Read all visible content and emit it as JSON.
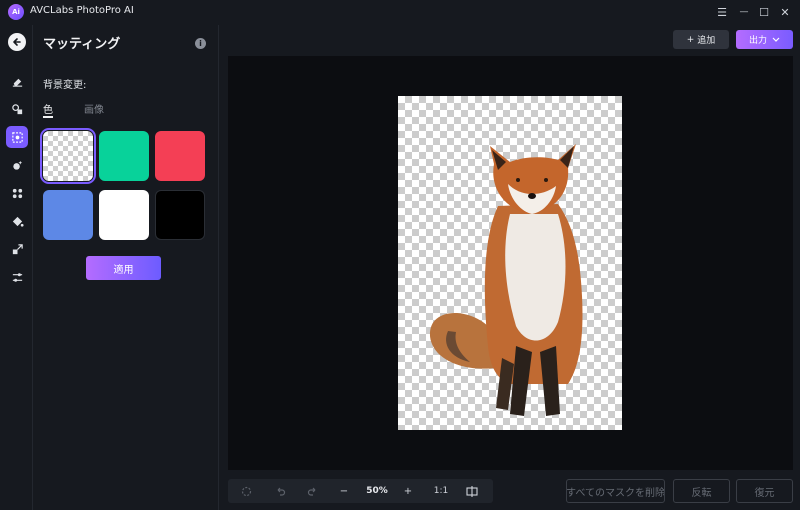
{
  "app": {
    "title": "AVCLabs PhotoPro AI",
    "logo_text": "Ai",
    "window_controls": {
      "menu": "☰",
      "minimize": "—",
      "maximize": "☐",
      "close": "✕"
    }
  },
  "rail": {
    "back": "arrow-left-icon",
    "items": [
      {
        "name": "eraser-icon"
      },
      {
        "name": "object-replace-icon"
      },
      {
        "name": "matting-icon",
        "active": true
      },
      {
        "name": "face-enhance-icon"
      },
      {
        "name": "effects-icon"
      },
      {
        "name": "fill-bucket-icon"
      },
      {
        "name": "upscale-icon"
      },
      {
        "name": "adjust-sliders-icon"
      }
    ]
  },
  "panel": {
    "title": "マッティング",
    "section_label": "背景変更:",
    "tabs": [
      {
        "label": "色",
        "active": true
      },
      {
        "label": "画像",
        "active": false
      }
    ],
    "swatches": [
      {
        "name": "transparent",
        "color": "transparent",
        "selected": true
      },
      {
        "name": "green",
        "color": "#08d29a",
        "selected": false
      },
      {
        "name": "red",
        "color": "#f43f55",
        "selected": false
      },
      {
        "name": "blue",
        "color": "#5d88e6",
        "selected": false
      },
      {
        "name": "white",
        "color": "#ffffff",
        "selected": false
      },
      {
        "name": "black",
        "color": "#000000",
        "selected": false
      }
    ],
    "apply_label": "適用"
  },
  "topbar": {
    "add_label": "追加",
    "add_icon": "+",
    "export_label": "出力",
    "export_icon": "chevron-down-icon"
  },
  "toolbar": {
    "zoom_out": "−",
    "zoom_value": "50%",
    "zoom_in": "+",
    "actual_size": "1:1",
    "compare_icon": "compare-icon"
  },
  "actions": {
    "delete_all_masks": "すべてのマスクを削除",
    "invert": "反転",
    "restore": "復元"
  },
  "colors": {
    "accent": "#7b5cff",
    "background": "#16191f",
    "canvas": "#0c0d11"
  }
}
